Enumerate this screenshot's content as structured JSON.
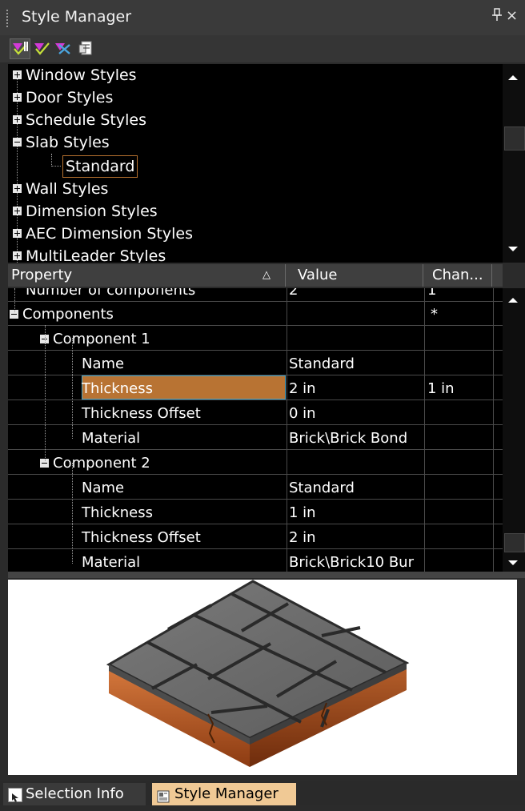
{
  "window": {
    "title": "Style Manager",
    "pin_glyph": "↕",
    "close_glyph": "×"
  },
  "toolbar": {
    "buttons": [
      {
        "icon": "filter-style-type-icon"
      },
      {
        "icon": "toggle-display-icon"
      },
      {
        "icon": "purge-styles-icon"
      },
      {
        "icon": "copy-style-icon"
      }
    ]
  },
  "tree": {
    "items": [
      {
        "label": "Window Styles",
        "expanded": false
      },
      {
        "label": "Door Styles",
        "expanded": false
      },
      {
        "label": "Schedule Styles",
        "expanded": false
      },
      {
        "label": "Slab Styles",
        "expanded": true
      },
      {
        "label": "Wall Styles",
        "expanded": false
      },
      {
        "label": "Dimension Styles",
        "expanded": false
      },
      {
        "label": "AEC Dimension Styles",
        "expanded": false
      },
      {
        "label": "MultiLeader Styles",
        "expanded": false
      }
    ],
    "selected_child": "Standard"
  },
  "properties": {
    "columns": [
      "Property",
      "Value",
      "Chan..."
    ],
    "sort_glyph": "△",
    "rows": [
      {
        "name": "Number of components",
        "value": "2",
        "changed": "1"
      },
      {
        "name": "Components",
        "value": "",
        "changed": "*"
      },
      {
        "name": "Component 1",
        "value": "",
        "changed": ""
      },
      {
        "name": "Name",
        "value": "Standard",
        "changed": ""
      },
      {
        "name": "Thickness",
        "value": "2 in",
        "changed": "1 in"
      },
      {
        "name": "Thickness Offset",
        "value": "0 in",
        "changed": ""
      },
      {
        "name": "Material",
        "value": "Brick\\Brick Bond",
        "changed": ""
      },
      {
        "name": "Component 2",
        "value": "",
        "changed": ""
      },
      {
        "name": "Name",
        "value": "Standard",
        "changed": ""
      },
      {
        "name": "Thickness",
        "value": "1 in",
        "changed": ""
      },
      {
        "name": "Thickness Offset",
        "value": "2 in",
        "changed": ""
      },
      {
        "name": "Material",
        "value": "Brick\\Brick10 Bur",
        "changed": ""
      }
    ]
  },
  "preview": {
    "description_icon": "brick-slab-preview",
    "top_color": "#6f6f6f",
    "side_color": "#c8642a"
  },
  "bottom_tabs": [
    {
      "label": "Selection Info",
      "icon": "selection-info-icon",
      "active": false
    },
    {
      "label": "Style Manager",
      "icon": "style-manager-icon",
      "active": true
    }
  ]
}
